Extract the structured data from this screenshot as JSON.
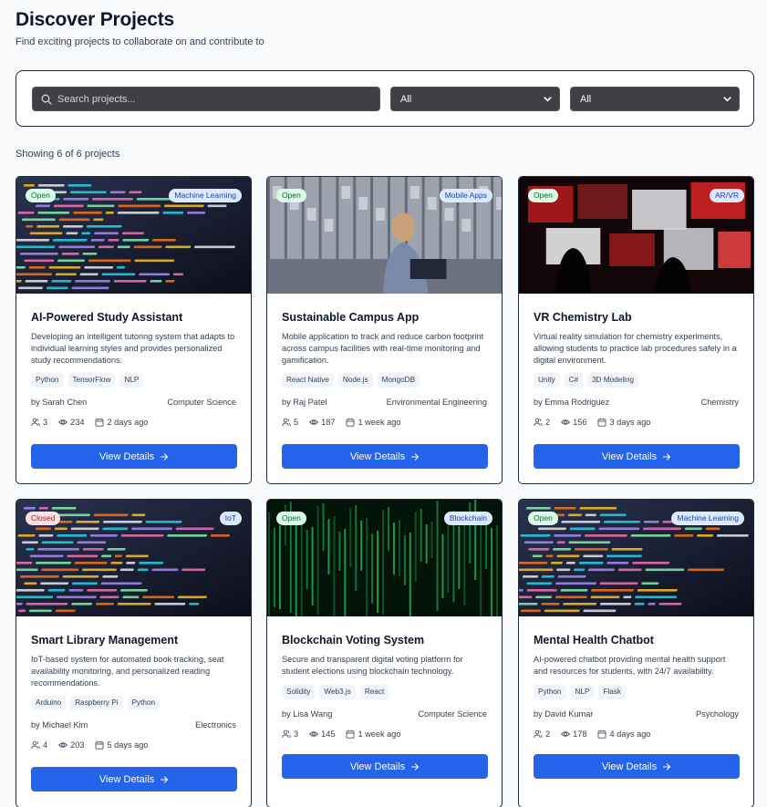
{
  "header": {
    "title": "Discover Projects",
    "subtitle": "Find exciting projects to collaborate on and contribute to"
  },
  "filters": {
    "search_placeholder": "Search projects...",
    "category_value": "All",
    "status_value": "All"
  },
  "results": {
    "count_text": "Showing 6 of 6 projects"
  },
  "view_button_label": "View Details",
  "colors": {
    "accent": "#2563eb",
    "open": "#dcfce7",
    "closed": "#fee2e2",
    "category": "#dbeafe"
  },
  "projects": [
    {
      "status": "Open",
      "category": "Machine Learning",
      "title": "AI-Powered Study Assistant",
      "description": "Developing an intelligent tutoring system that adapts to individual learning styles and provides personalized study recommendations.",
      "tags": [
        "Python",
        "TensorFlow",
        "NLP"
      ],
      "author": "by Sarah Chen",
      "department": "Computer Science",
      "members": "3",
      "views": "234",
      "posted": "2 days ago",
      "image_icon": "code-screen-photo"
    },
    {
      "status": "Open",
      "category": "Mobile Apps",
      "title": "Sustainable Campus App",
      "description": "Mobile application to track and reduce carbon footprint across campus facilities with real-time monitoring and gamification.",
      "tags": [
        "React Native",
        "Node.js",
        "MongoDB"
      ],
      "author": "by Raj Patel",
      "department": "Environmental Engineering",
      "members": "5",
      "views": "187",
      "posted": "1 week ago",
      "image_icon": "lab-photo"
    },
    {
      "status": "Open",
      "category": "AR/VR",
      "title": "VR Chemistry Lab",
      "description": "Virtual reality simulation for chemistry experiments, allowing students to practice lab procedures safely in a digital environment.",
      "tags": [
        "Unity",
        "C#",
        "3D Modeling"
      ],
      "author": "by Emma Rodriguez",
      "department": "Chemistry",
      "members": "2",
      "views": "156",
      "posted": "3 days ago",
      "image_icon": "screens-photo"
    },
    {
      "status": "Closed",
      "category": "IoT",
      "title": "Smart Library Management",
      "description": "IoT-based system for automated book tracking, seat availability monitoring, and personalized reading recommendations.",
      "tags": [
        "Arduino",
        "Raspberry Pi",
        "Python"
      ],
      "author": "by Michael Kim",
      "department": "Electronics",
      "members": "4",
      "views": "203",
      "posted": "5 days ago",
      "image_icon": "code-screen-photo"
    },
    {
      "status": "Open",
      "category": "Blockchain",
      "title": "Blockchain Voting System",
      "description": "Secure and transparent digital voting platform for student elections using blockchain technology.",
      "tags": [
        "Solidity",
        "Web3.js",
        "React"
      ],
      "author": "by Lisa Wang",
      "department": "Computer Science",
      "members": "3",
      "views": "145",
      "posted": "1 week ago",
      "image_icon": "matrix-photo"
    },
    {
      "status": "Open",
      "category": "Machine Learning",
      "title": "Mental Health Chatbot",
      "description": "AI-powered chatbot providing mental health support and resources for students, with 24/7 availability.",
      "tags": [
        "Python",
        "NLP",
        "Flask"
      ],
      "author": "by David Kumar",
      "department": "Psychology",
      "members": "2",
      "views": "178",
      "posted": "4 days ago",
      "image_icon": "code-screen-photo"
    }
  ]
}
